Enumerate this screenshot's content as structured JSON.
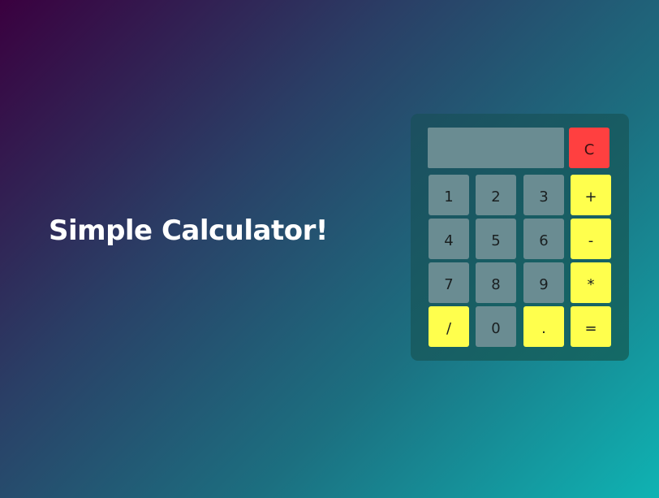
{
  "page": {
    "title": "Simple Calculator!"
  },
  "calculator": {
    "display_value": "",
    "clear_label": "C",
    "keys": {
      "one": "1",
      "two": "2",
      "three": "3",
      "plus": "+",
      "four": "4",
      "five": "5",
      "six": "6",
      "minus": "-",
      "seven": "7",
      "eight": "8",
      "nine": "9",
      "multiply": "*",
      "divide": "/",
      "zero": "0",
      "decimal": ".",
      "equals": "="
    }
  },
  "colors": {
    "number_key": "#6a8c92",
    "operator_key": "#ffff4d",
    "clear_key": "#ff4040",
    "calculator_body": "#175a63"
  }
}
